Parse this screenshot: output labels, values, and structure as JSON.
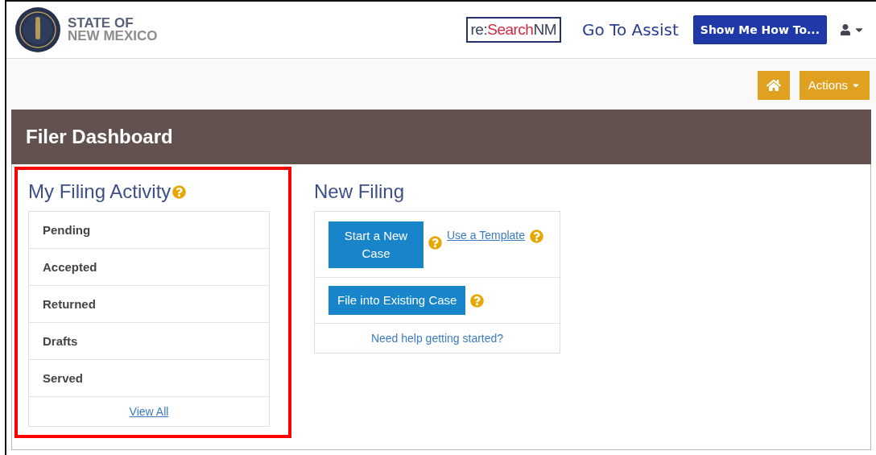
{
  "header": {
    "state_name": {
      "line_1": "STATE OF",
      "line_2": "NEW MEXICO"
    },
    "partner_logo": {
      "part_1": "re:",
      "part_2": "Search",
      "part_3": "NM"
    },
    "assist_link": "Go To Assist",
    "how_to_button": "Show Me How To..."
  },
  "toolbar": {
    "actions_button": "Actions"
  },
  "dashboard": {
    "title": "Filer Dashboard",
    "activity": {
      "title": "My Filing Activity",
      "highlighted": true,
      "items": [
        "Pending",
        "Accepted",
        "Returned",
        "Drafts",
        "Served"
      ],
      "view_all": "View All"
    },
    "new_filing": {
      "title": "New Filing",
      "start_button": "Start a New Case",
      "template_link": "Use a Template",
      "existing_button": "File into Existing Case",
      "help_link": "Need help getting started?"
    }
  }
}
